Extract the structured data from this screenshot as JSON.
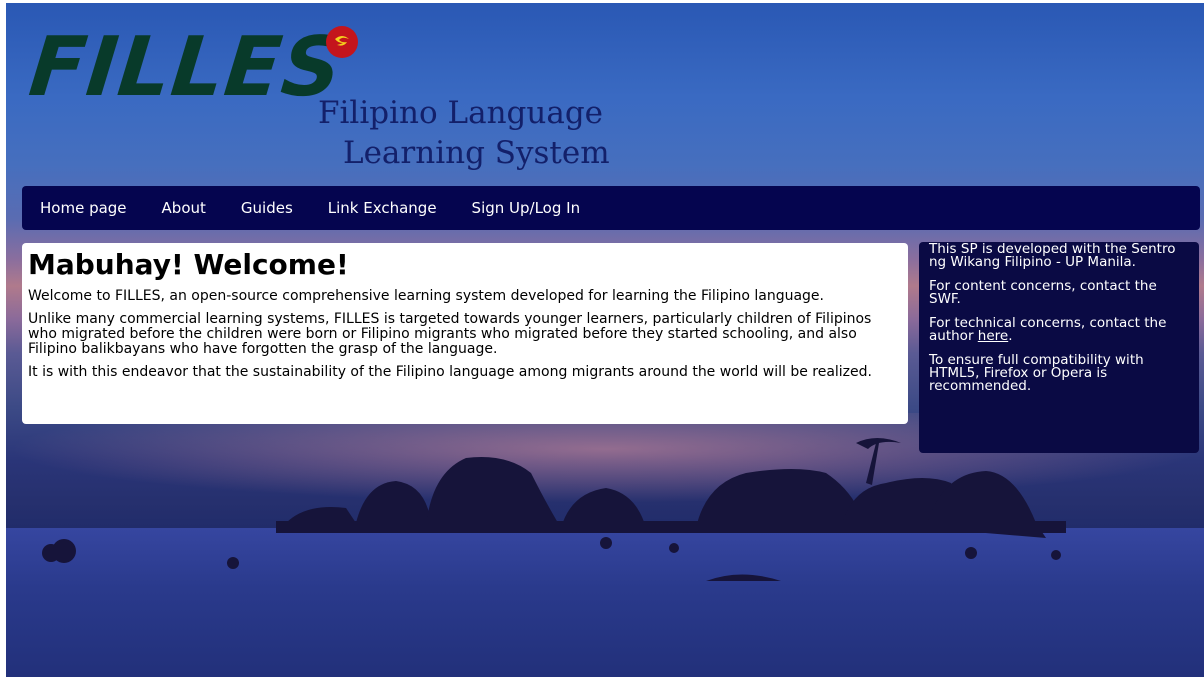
{
  "logo": {
    "title": "FILLES",
    "subtitle_line1": "Filipino Language",
    "subtitle_line2": "Learning System",
    "badge_icon": "swirl-icon"
  },
  "nav": {
    "items": [
      "Home page",
      "About",
      "Guides",
      "Link Exchange",
      "Sign Up/Log In"
    ]
  },
  "welcome": {
    "heading": "Mabuhay! Welcome!",
    "paragraphs": [
      "Welcome to FILLES, an open-source comprehensive learning system developed for learning the Filipino language.",
      "Unlike many commercial learning systems, FILLES is targeted towards younger learners, particularly children of Filipinos who migrated before the children were born or Filipino migrants who migrated before they started schooling, and also Filipino balikbayans who have forgotten the grasp of the language.",
      "It is with this endeavor that the sustainability of the Filipino language among migrants around the world will be realized."
    ]
  },
  "sidebar": {
    "p1": "This SP is developed with the Sentro ng Wikang Filipino - UP Manila.",
    "p2": "For content concerns, contact the SWF.",
    "p3_before": "For technical concerns, contact the author ",
    "p3_link": "here",
    "p3_after": ".",
    "p4": "To ensure full compatibility with HTML5, Firefox or Opera is recommended."
  },
  "colors": {
    "nav_bg": "#05054f",
    "logo_green": "#083a2a",
    "tagline_blue": "#13206a",
    "badge_red": "#c4151c",
    "sidebar_bg": "#0a0a44"
  }
}
